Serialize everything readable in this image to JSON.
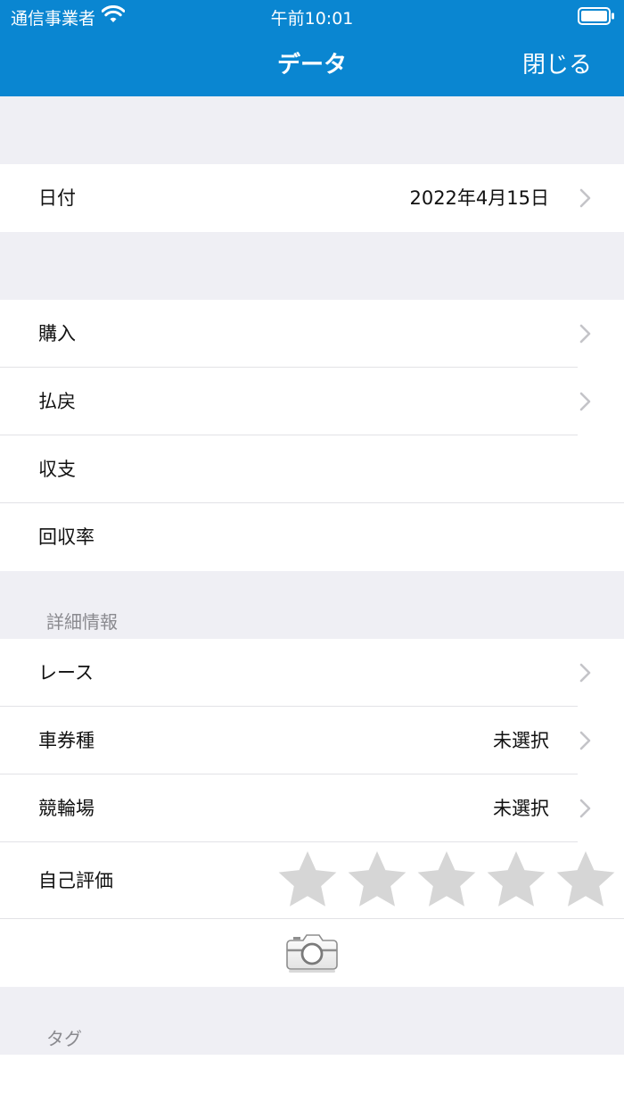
{
  "status_bar": {
    "carrier": "通信事業者",
    "time": "午前10:01"
  },
  "nav": {
    "title": "データ",
    "close_label": "閉じる"
  },
  "date_row": {
    "label": "日付",
    "value": "2022年4月15日"
  },
  "summary": {
    "purchase": "購入",
    "payout": "払戻",
    "balance": "収支",
    "recovery_rate": "回収率"
  },
  "details": {
    "header": "詳細情報",
    "race_label": "レース",
    "ticket_type_label": "車券種",
    "ticket_type_value": "未選択",
    "velodrome_label": "競輪場",
    "velodrome_value": "未選択",
    "self_rating_label": "自己評価",
    "self_rating_value": 0,
    "self_rating_max": 5
  },
  "tags": {
    "header": "タグ"
  },
  "colors": {
    "accent": "#0a86d1",
    "star_empty": "#d6d6d6",
    "chevron": "#c4c4c8"
  },
  "icons": [
    "wifi-icon",
    "battery-icon",
    "chevron-right-icon",
    "star-icon",
    "camera-icon"
  ]
}
